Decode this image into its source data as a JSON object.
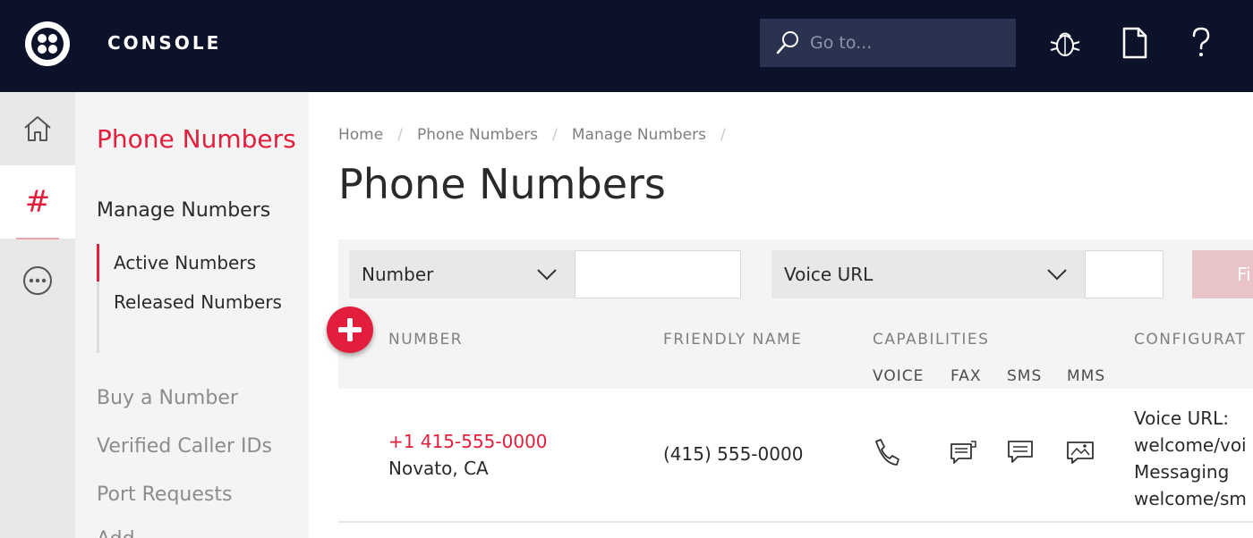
{
  "topbar": {
    "brand": "CONSOLE",
    "search_placeholder": "Go to...",
    "icons": [
      "bug-icon",
      "docs-icon",
      "help-icon"
    ]
  },
  "rail": {
    "items": [
      "home-icon",
      "hash-icon",
      "more-icon"
    ],
    "hash_glyph": "#"
  },
  "sidebar": {
    "title": "Phone Numbers",
    "section": "Manage Numbers",
    "subitems": [
      "Active Numbers",
      "Released Numbers"
    ],
    "links": [
      "Buy a Number",
      "Verified Caller IDs",
      "Port Requests",
      "Add..."
    ]
  },
  "main": {
    "breadcrumb": [
      "Home",
      "Phone Numbers",
      "Manage Numbers"
    ],
    "title": "Phone Numbers",
    "filters": {
      "select1": "Number",
      "select2": "Voice URL",
      "button": "Fi"
    },
    "table": {
      "headers": [
        "NUMBER",
        "FRIENDLY NAME",
        "CAPABILITIES",
        "CONFIGURAT"
      ],
      "capabilities": [
        "VOICE",
        "FAX",
        "SMS",
        "MMS"
      ],
      "rows": [
        {
          "number": "+1 415-555-0000",
          "location": "Novato, CA",
          "friendly_name": "(415) 555-0000",
          "config": [
            "Voice  URL:",
            "welcome/voi",
            "Messaging",
            "welcome/sm"
          ]
        }
      ]
    }
  },
  "colors": {
    "topbar": "#0d122b",
    "accent": "#e31e3c",
    "muted": "#7d7f80"
  }
}
